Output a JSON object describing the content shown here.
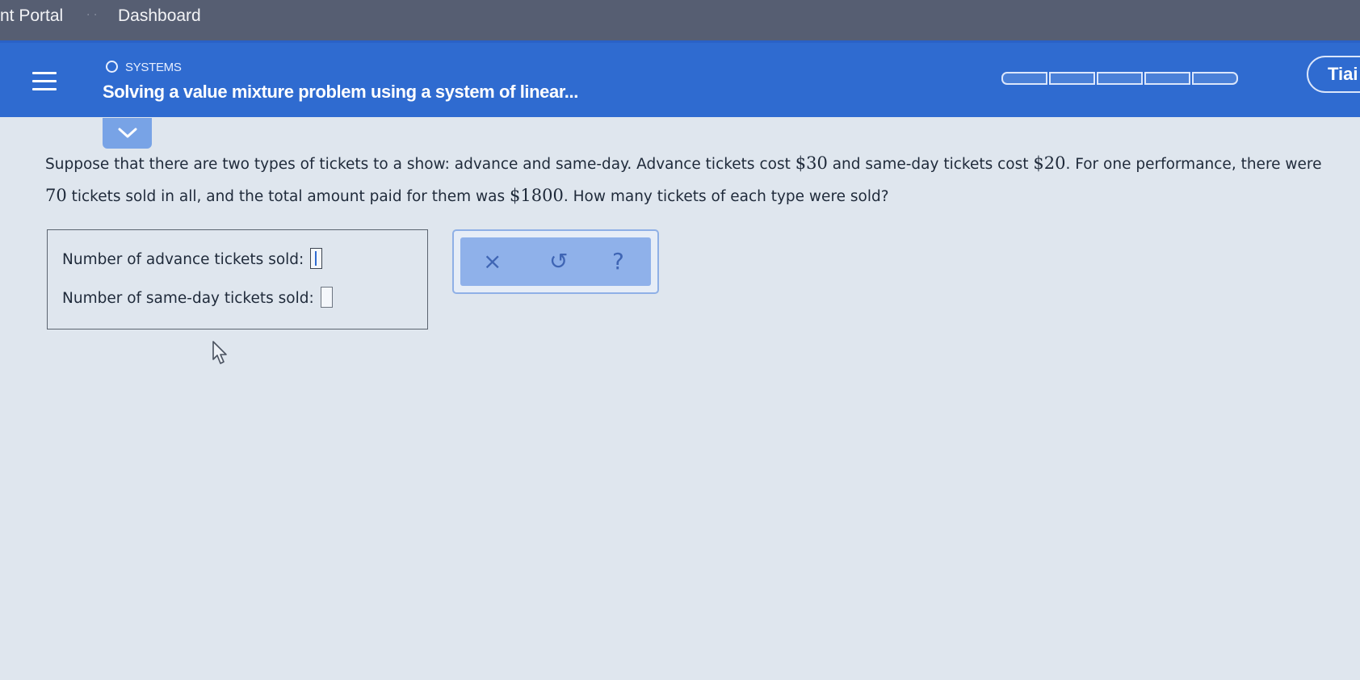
{
  "browser": {
    "tab_portal": "nt Portal",
    "tab_dashboard": "Dashboard"
  },
  "header": {
    "breadcrumb": "SYSTEMS",
    "topic_title": "Solving a value mixture problem using a system of linear...",
    "progress_segments": 5,
    "user_button": "Tiai"
  },
  "question": {
    "p1": "Suppose that there are two types of tickets to a show: advance and same-day. Advance tickets cost ",
    "v1": "$30",
    "p2": " and same-day tickets cost ",
    "v2": "$20",
    "p3": ". For one performance, there were ",
    "v3": "70",
    "p4": " tickets sold in all, and the total amount paid for them was ",
    "v4": "$1800",
    "p5": ". How many tickets of each type were sold?"
  },
  "answers": {
    "advance_label": "Number of advance tickets sold:",
    "advance_value": "",
    "sameday_label": "Number of same-day tickets sold:",
    "sameday_value": ""
  },
  "tools": {
    "clear": "×",
    "undo": "↺",
    "help": "?"
  },
  "colors": {
    "header_blue": "#2f6bd0",
    "tool_blue": "#8fb1ea",
    "page_bg": "#dfe6ee"
  }
}
